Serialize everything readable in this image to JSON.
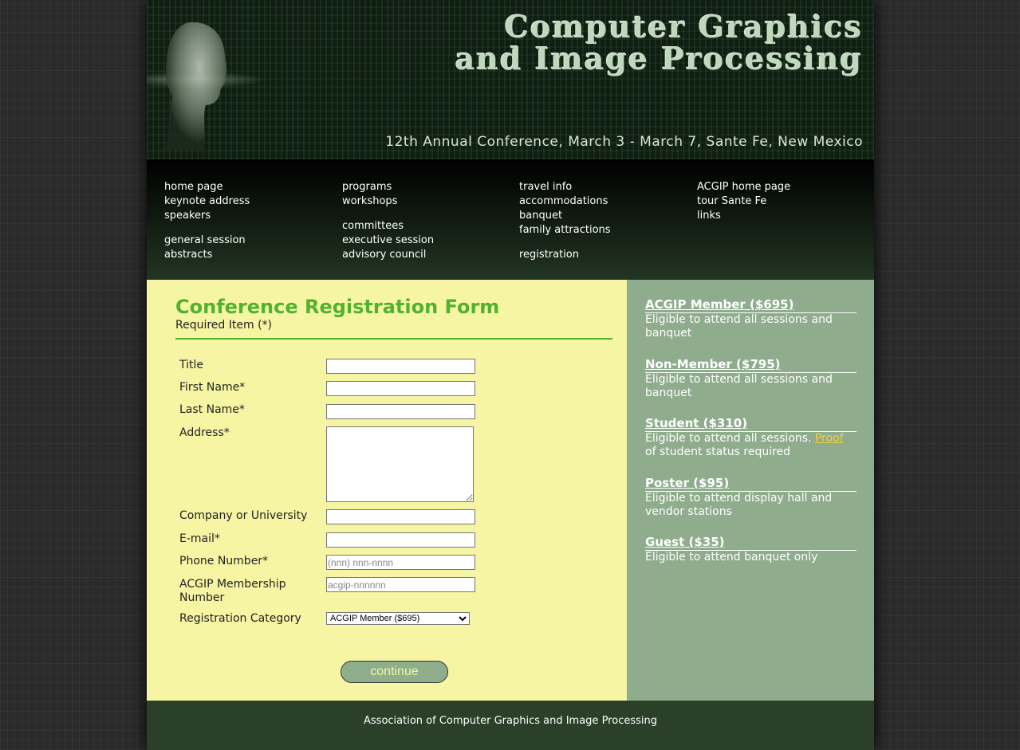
{
  "banner": {
    "title_line1": "Computer Graphics",
    "title_line2": "and Image Processing",
    "subtitle": "12th Annual Conference, March 3 - March 7, Sante Fe, New Mexico"
  },
  "nav": {
    "col1": [
      "home page",
      "keynote address",
      "speakers",
      "general session",
      "abstracts"
    ],
    "col2": [
      "programs",
      "workshops",
      "committees",
      "executive session",
      "advisory council"
    ],
    "col3": [
      "travel info",
      "accommodations",
      "banquet",
      "family attractions",
      "registration"
    ],
    "col4": [
      "ACGIP home page",
      "tour Sante Fe",
      "links"
    ]
  },
  "form": {
    "title": "Conference Registration Form",
    "required_note": "Required Item (*)",
    "labels": {
      "title": "Title",
      "first_name": "First Name*",
      "last_name": "Last Name*",
      "address": "Address*",
      "company": "Company or University",
      "email": "E-mail*",
      "phone": "Phone Number*",
      "membership": "ACGIP Membership Number",
      "category": "Registration Category"
    },
    "placeholders": {
      "phone": "(nnn) nnn-nnnn",
      "membership": "acgip-nnnnnn"
    },
    "category_selected": "ACGIP Member ($695)",
    "continue_label": "continue"
  },
  "categories": [
    {
      "title": "ACGIP Member ($695)",
      "desc": "Eligible to attend all sessions and banquet"
    },
    {
      "title": "Non-Member ($795)",
      "desc": "Eligible to attend all sessions and banquet"
    },
    {
      "title": "Student ($310)",
      "desc_before": "Eligible to attend all sessions.",
      "link": "Proof",
      "desc_after": "of student status required"
    },
    {
      "title": "Poster ($95)",
      "desc": "Eligible to attend display hall and vendor stations"
    },
    {
      "title": "Guest ($35)",
      "desc": "Eligible to attend banquet only"
    }
  ],
  "footer": {
    "text": "Association of Computer Graphics and Image Processing"
  },
  "colors": {
    "form_bg": "#f5f5a3",
    "accent_green": "#52b230",
    "sidebar_bg": "#8fac8d",
    "dark_green": "#2a4029",
    "link_yellow": "#f5d23b"
  }
}
